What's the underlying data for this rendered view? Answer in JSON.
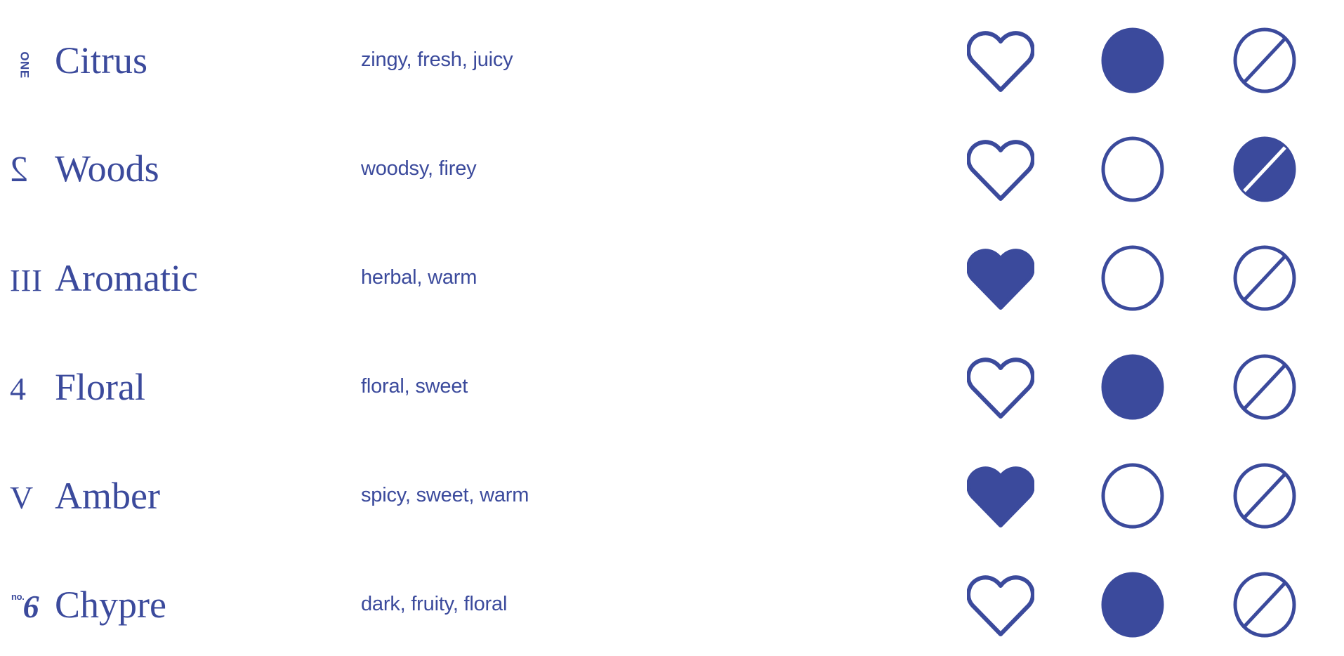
{
  "palette": {
    "brand_blue": "#3B4A9C",
    "background": "#FFFFFF"
  },
  "columns": {
    "numeral": "numeral",
    "family": "family",
    "descriptors": "descriptors",
    "icons": [
      "heart",
      "circle",
      "slashed-circle"
    ]
  },
  "rows": [
    {
      "numeral": "ONE",
      "numeral_style": "vertical-word",
      "name": "Citrus",
      "descriptors": "zingy, fresh, juicy",
      "heart": "outline",
      "circle": "filled",
      "slash": "outline"
    },
    {
      "numeral": "2",
      "numeral_style": "mirrored-digit",
      "name": "Woods",
      "descriptors": "woodsy, firey",
      "heart": "outline",
      "circle": "outline",
      "slash": "filled"
    },
    {
      "numeral": "III",
      "numeral_style": "roman",
      "name": "Aromatic",
      "descriptors": "herbal, warm",
      "heart": "filled",
      "circle": "outline",
      "slash": "outline"
    },
    {
      "numeral": "4",
      "numeral_style": "oldstyle-digit",
      "name": "Floral",
      "descriptors": "floral, sweet",
      "heart": "outline",
      "circle": "filled",
      "slash": "outline"
    },
    {
      "numeral": "V",
      "numeral_style": "roman",
      "name": "Amber",
      "descriptors": "spicy, sweet, warm",
      "heart": "filled",
      "circle": "outline",
      "slash": "outline"
    },
    {
      "numeral": "6",
      "numeral_prefix": "no.",
      "numeral_style": "no-bold-italic-digit",
      "name": "Chypre",
      "descriptors": "dark, fruity, floral",
      "heart": "outline",
      "circle": "filled",
      "slash": "outline"
    }
  ]
}
